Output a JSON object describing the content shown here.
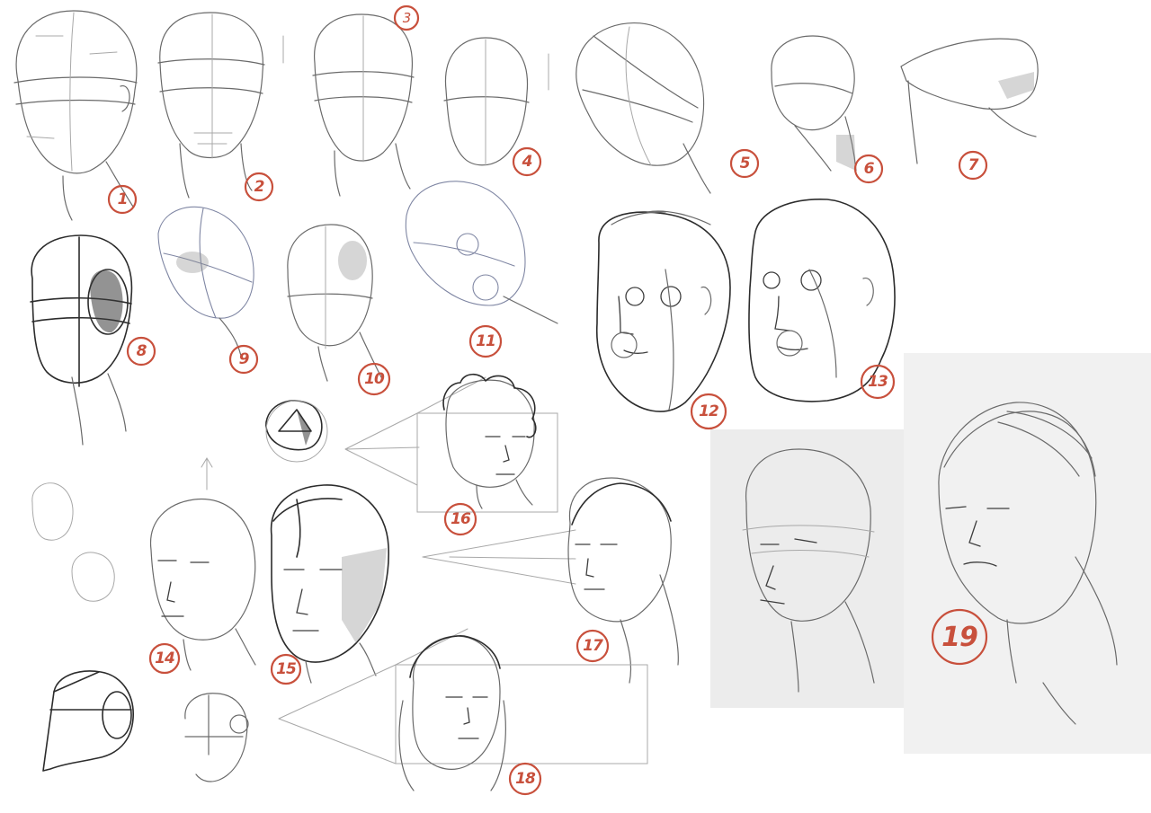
{
  "sheet": {
    "accent_color": "#c8503c",
    "badges": [
      "1",
      "2",
      "3",
      "4",
      "5",
      "6",
      "7",
      "8",
      "9",
      "10",
      "11",
      "12",
      "13",
      "14",
      "15",
      "16",
      "17",
      "18",
      "19"
    ]
  }
}
